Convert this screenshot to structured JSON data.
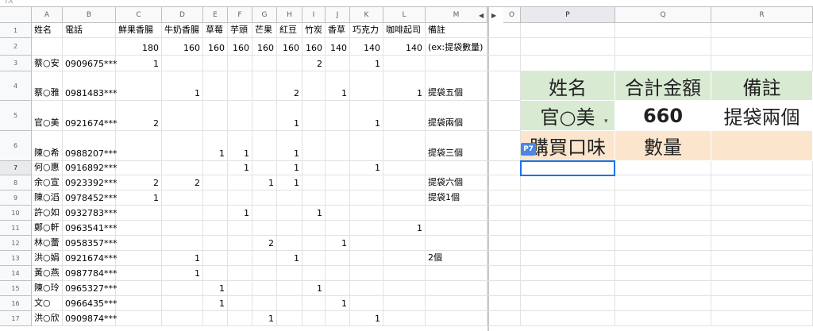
{
  "formula_bar": {
    "fx": "fx"
  },
  "columns": [
    "A",
    "B",
    "C",
    "D",
    "E",
    "F",
    "G",
    "H",
    "I",
    "J",
    "K",
    "L",
    "M",
    "O",
    "P",
    "Q",
    "R"
  ],
  "selected_column": "P",
  "selected_row": "7",
  "rows": [
    "1",
    "2",
    "3",
    "4",
    "5",
    "6",
    "7",
    "8",
    "9",
    "10",
    "11",
    "12",
    "13",
    "14",
    "15",
    "16",
    "17"
  ],
  "scroll_controls": {
    "left": "◀",
    "right": "▶"
  },
  "grid": {
    "header_row": [
      "姓名",
      "電話",
      "鮮果香腸",
      "牛奶香腸",
      "草莓",
      "芋頭",
      "芒果",
      "紅豆",
      "竹炭",
      "香草",
      "巧克力",
      "咖啡起司",
      "備註"
    ],
    "quantity_row": [
      "",
      "",
      "180",
      "160",
      "160",
      "160",
      "160",
      "160",
      "160",
      "140",
      "140",
      "140",
      "(ex:提袋數量)"
    ],
    "data": [
      [
        "蔡○安",
        "0909675***",
        "1",
        "",
        "",
        "",
        "",
        "",
        "2",
        "",
        "1",
        "",
        ""
      ],
      [
        "蔡○雅",
        "0981483***",
        "",
        "1",
        "",
        "",
        "",
        "2",
        "",
        "1",
        "",
        "1",
        "提袋五個"
      ],
      [
        "官○美",
        "0921674***",
        "2",
        "",
        "",
        "",
        "",
        "1",
        "",
        "",
        "1",
        "",
        "提袋兩個"
      ],
      [
        "陳○希",
        "0988207***",
        "",
        "",
        "1",
        "1",
        "",
        "1",
        "",
        "",
        "",
        "",
        "提袋三個"
      ],
      [
        "何○惠",
        "0916892***",
        "",
        "",
        "",
        "1",
        "",
        "1",
        "",
        "",
        "1",
        "",
        ""
      ],
      [
        "余○宣",
        "0923392***",
        "2",
        "2",
        "",
        "",
        "1",
        "1",
        "",
        "",
        "",
        "",
        "提袋六個"
      ],
      [
        "陳○滔",
        "0978452***",
        "1",
        "",
        "",
        "",
        "",
        "",
        "",
        "",
        "",
        "",
        "提袋1個"
      ],
      [
        "許○如",
        "0932783***",
        "",
        "",
        "",
        "1",
        "",
        "",
        "1",
        "",
        "",
        "",
        ""
      ],
      [
        "鄭○軒",
        "0963541***",
        "",
        "",
        "",
        "",
        "",
        "",
        "",
        "",
        "",
        "1",
        ""
      ],
      [
        "林○蕾",
        "0958357***",
        "",
        "",
        "",
        "",
        "2",
        "",
        "",
        "1",
        "",
        "",
        ""
      ],
      [
        "洪○娟",
        "0921674***",
        "",
        "1",
        "",
        "",
        "",
        "1",
        "",
        "",
        "",
        "",
        "2個"
      ],
      [
        "黃○燕",
        "0987784***",
        "",
        "1",
        "",
        "",
        "",
        "",
        "",
        "",
        "",
        "",
        ""
      ],
      [
        "陳○玲",
        "0965327***",
        "",
        "",
        "1",
        "",
        "",
        "",
        "1",
        "",
        "",
        "",
        ""
      ],
      [
        "文○",
        "0966435***",
        "",
        "",
        "1",
        "",
        "",
        "",
        "",
        "1",
        "",
        "",
        ""
      ],
      [
        "洪○欣",
        "0909874***",
        "",
        "",
        "",
        "",
        "1",
        "",
        "",
        "",
        "1",
        "",
        ""
      ]
    ]
  },
  "summary": {
    "header": [
      "姓名",
      "合計金額",
      "備註"
    ],
    "name_value": "官○美",
    "total_value": "660",
    "note_value": "提袋兩個",
    "flavor_label": "購買口味",
    "qty_label": "數量",
    "colors": {
      "green": "#d9ead3",
      "orange": "#fce5cd"
    }
  },
  "cell_tag": "P7"
}
